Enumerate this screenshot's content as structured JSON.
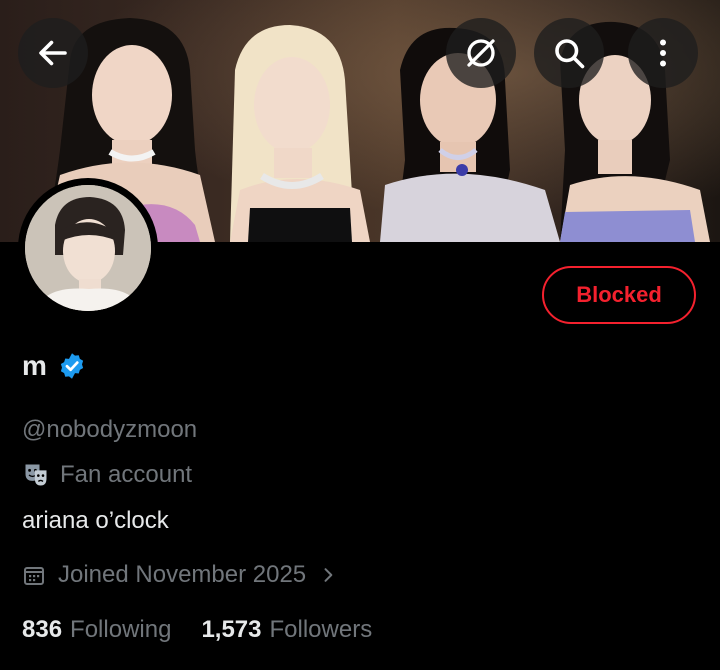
{
  "header": {
    "back_icon": "arrow-left-icon",
    "translate_icon": "no-translate-icon",
    "search_icon": "search-icon",
    "more_icon": "more-vertical-icon"
  },
  "profile": {
    "name": "m",
    "verified_icon": "verified-badge-icon",
    "handle": "@nobodyzmoon",
    "category_icon": "theater-masks-icon",
    "category": "Fan account",
    "bio": "ariana o’clock",
    "joined_icon": "calendar-icon",
    "joined": "Joined November 2025",
    "following_count": "836",
    "following_label": "Following",
    "followers_count": "1,573",
    "followers_label": "Followers"
  },
  "actions": {
    "blocked_label": "Blocked"
  },
  "colors": {
    "accent_red": "#f4212e",
    "verified_blue": "#1d9bf0",
    "muted_text": "#71767b",
    "primary_text": "#e7e9ea",
    "background": "#000000"
  }
}
